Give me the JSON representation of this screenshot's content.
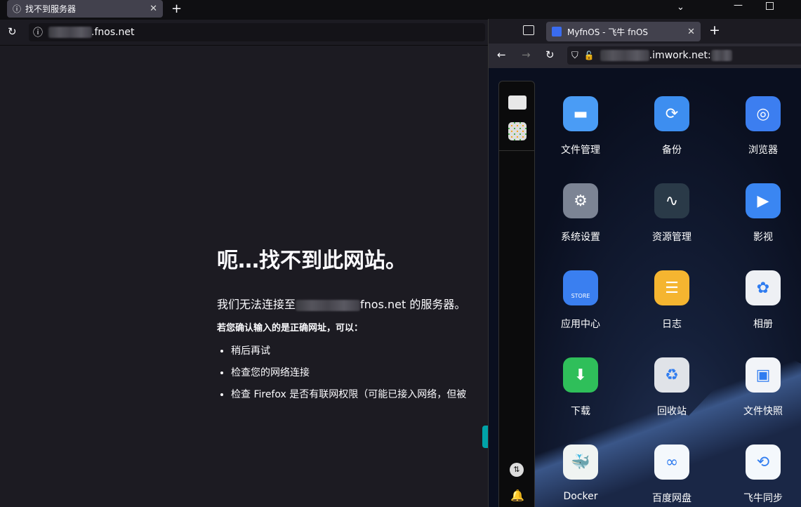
{
  "main_browser": {
    "tab_title": "找不到服务器",
    "url_suffix": ".fnos.net",
    "icons": {
      "reload": "reload-icon",
      "info": "info-icon",
      "new_tab": "plus-icon",
      "close": "close-icon"
    }
  },
  "error_page": {
    "title": "呃…找不到此网站。",
    "message_prefix": "我们无法连接至",
    "message_suffix": "fnos.net 的服务器。",
    "hint": "若您确认输入的是正确网址，可以：",
    "tips": [
      "稍后再试",
      "检查您的网络连接",
      "检查 Firefox 是否有联网权限（可能已接入网络，但被"
    ]
  },
  "second_browser": {
    "tab_title": "MyfnOS - 飞牛 fnOS",
    "url_suffix": ".imwork.net:"
  },
  "desktop": {
    "apps": [
      {
        "label": "文件管理",
        "icon": "folder-icon",
        "color": "#4a9cf5"
      },
      {
        "label": "备份",
        "icon": "backup-icon",
        "color": "#3d8ef0"
      },
      {
        "label": "浏览器",
        "icon": "browser-icon",
        "color": "#3c7ef0"
      },
      {
        "label": "系统设置",
        "icon": "settings-icon",
        "color": "#7c8494"
      },
      {
        "label": "资源管理",
        "icon": "resource-monitor-icon",
        "color": "#2a3a48"
      },
      {
        "label": "影视",
        "icon": "video-icon",
        "color": "#3a86f2"
      },
      {
        "label": "应用中心",
        "icon": "store-icon",
        "color": "#3a7ff0"
      },
      {
        "label": "日志",
        "icon": "log-icon",
        "color": "#f5b530"
      },
      {
        "label": "相册",
        "icon": "photos-icon",
        "color": "#eef0f4"
      },
      {
        "label": "下载",
        "icon": "download-icon",
        "color": "#2fbf5a"
      },
      {
        "label": "回收站",
        "icon": "recycle-bin-icon",
        "color": "#e0e3e8"
      },
      {
        "label": "文件快照",
        "icon": "file-snapshot-icon",
        "color": "#f2f4f8"
      },
      {
        "label": "Docker",
        "icon": "docker-icon",
        "color": "#f0f4f2"
      },
      {
        "label": "百度网盘",
        "icon": "baidu-netdisk-icon",
        "color": "#f4f8fc"
      },
      {
        "label": "飞牛同步",
        "icon": "sync-icon",
        "color": "#f4f8fc"
      }
    ],
    "store_text": "STORE"
  }
}
